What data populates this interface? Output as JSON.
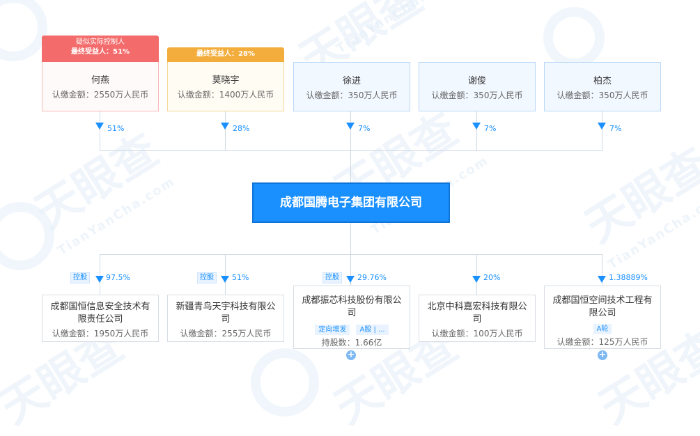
{
  "watermark": {
    "brand": "天眼查",
    "domain": "TianYanCha.com"
  },
  "center_company": {
    "name": "成都国腾电子集团有限公司"
  },
  "shareholders": [
    {
      "name": "何燕",
      "amount": "认缴金额：2550万人民币",
      "pct": "51%",
      "badge_line1": "疑似实际控制人",
      "badge_line2": "最终受益人：51%"
    },
    {
      "name": "莫晓宇",
      "amount": "认缴金额：1400万人民币",
      "pct": "28%",
      "badge_line1": "最终受益人：28%"
    },
    {
      "name": "徐进",
      "amount": "认缴金额：350万人民币",
      "pct": "7%"
    },
    {
      "name": "谢俊",
      "amount": "认缴金额：350万人民币",
      "pct": "7%"
    },
    {
      "name": "柏杰",
      "amount": "认缴金额：350万人民币",
      "pct": "7%"
    }
  ],
  "investments": [
    {
      "name": "成都国恒信息安全技术有限责任公司",
      "amount": "认缴金额：1950万人民币",
      "pct": "97.5%",
      "tag": "控股"
    },
    {
      "name": "新疆青鸟天宇科技有限公司",
      "amount": "认缴金额：255万人民币",
      "pct": "51%",
      "tag": "控股"
    },
    {
      "name": "成都振芯科技股份有限公司",
      "amount": "持股数：1.66亿",
      "pct": "29.76%",
      "tag": "控股",
      "chips": [
        "定向增发",
        "A股 | ..."
      ],
      "plus": "+"
    },
    {
      "name": "北京中科嘉宏科技有限公司",
      "amount": "认缴金额：100万人民币",
      "pct": "20%"
    },
    {
      "name": "成都国恒空间技术工程有限公司",
      "amount": "认缴金额：125万人民币",
      "pct": "1.38889%",
      "chips": [
        "A轮"
      ],
      "plus": "+"
    }
  ]
}
